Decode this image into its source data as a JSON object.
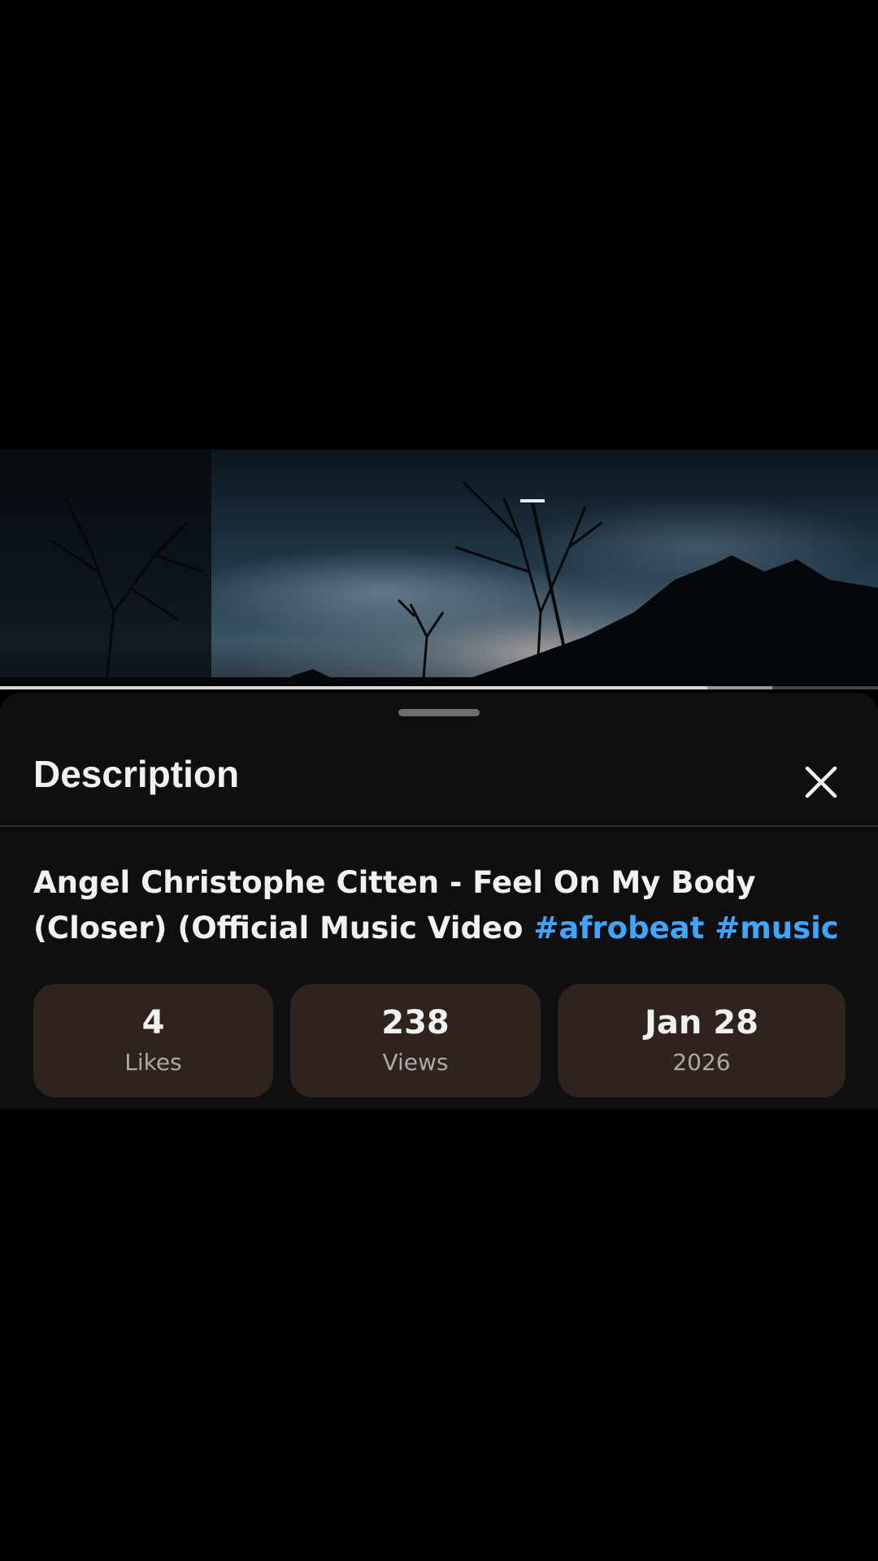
{
  "video": {
    "progress_fraction": 0.806,
    "buffered_fraction": 0.88
  },
  "sheet": {
    "title": "Description",
    "close_icon": "close-icon",
    "video_title_text": "Angel Christophe Citten - Feel On My Body (Closer) (Official Music Video",
    "hashtags": [
      "#afrobeat",
      "#music"
    ],
    "hashtag_color": "#3ea6ff"
  },
  "stats": [
    {
      "value": "4",
      "label": "Likes"
    },
    {
      "value": "238",
      "label": "Views"
    },
    {
      "value": "Jan 28",
      "label": "2026"
    }
  ],
  "colors": {
    "background": "#000000",
    "sheet_background": "#0f0f0f",
    "stat_card_background": "#2f231d"
  }
}
